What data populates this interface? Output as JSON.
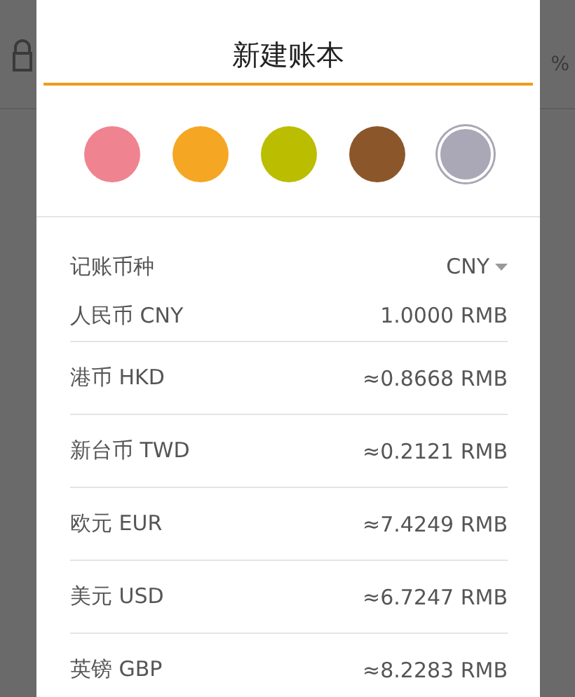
{
  "background": {
    "percent_text": "%"
  },
  "dialog": {
    "name_field": {
      "value": "新建账本"
    },
    "colors": [
      {
        "color": "#f08390",
        "selected": false
      },
      {
        "color": "#f5a623",
        "selected": false
      },
      {
        "color": "#bbbd00",
        "selected": false
      },
      {
        "color": "#8b572a",
        "selected": false
      },
      {
        "color": "#aaa8b6",
        "selected": true
      }
    ],
    "currency_label": "记账币种",
    "currency_value": "CNY",
    "rates": [
      {
        "name": "人民币 CNY",
        "rate": "1.0000 RMB"
      },
      {
        "name": "港币 HKD",
        "rate": "≈0.8668 RMB"
      },
      {
        "name": "新台币 TWD",
        "rate": "≈0.2121 RMB"
      },
      {
        "name": "欧元 EUR",
        "rate": "≈7.4249 RMB"
      },
      {
        "name": "美元 USD",
        "rate": "≈6.7247 RMB"
      },
      {
        "name": "英镑 GBP",
        "rate": "≈8.2283 RMB"
      }
    ]
  }
}
